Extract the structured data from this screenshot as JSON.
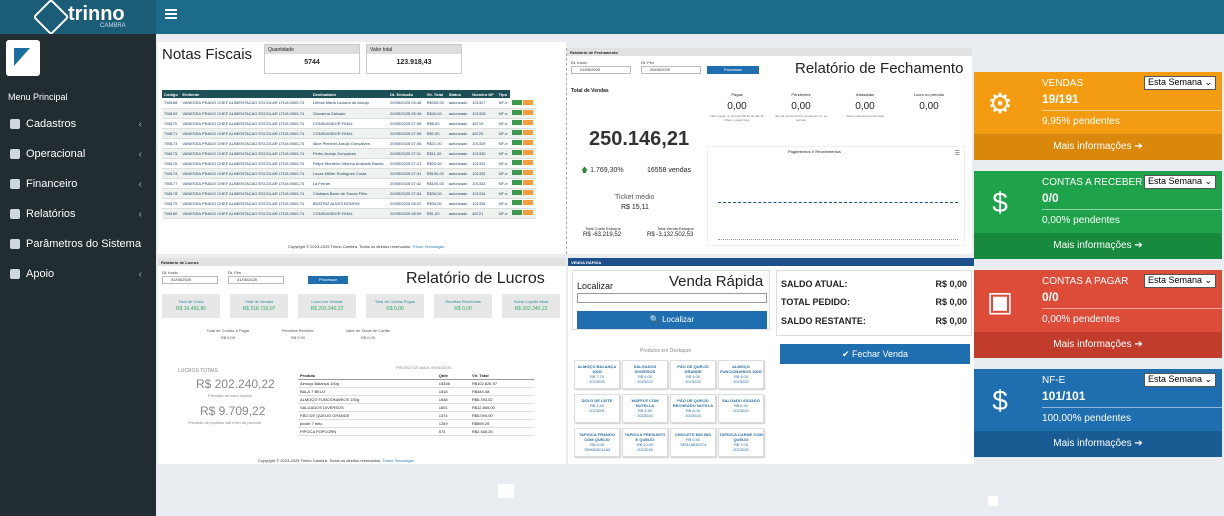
{
  "brand": {
    "name": "trinno",
    "sub": "CAMBRA"
  },
  "sidebar": {
    "header": "Menu Principal",
    "items": [
      {
        "label": "Cadastros"
      },
      {
        "label": "Operacional"
      },
      {
        "label": "Financeiro"
      },
      {
        "label": "Relatórios"
      },
      {
        "label": "Parâmetros do Sistema"
      },
      {
        "label": "Apoio"
      }
    ]
  },
  "notas": {
    "title": "Notas Fiscais",
    "qty_label": "Quantidade",
    "qty": "5744",
    "total_label": "Valor total",
    "total": "123.918,43",
    "columns": [
      "Código",
      "Emitente",
      "Destinatário",
      "Dt. Emissão",
      "Vlr. Total",
      "Status",
      "Número NF",
      "Tipo"
    ],
    "rows": [
      [
        "798188",
        "VANESSA PRADO CHEF ALIMENTACAO ESCOLAR LTDA 0000-74",
        "Letícia Maria Luciano de Araújo",
        "20/05/2025 05:48",
        "R$305,00",
        "autorizado",
        "100",
        "101327",
        "NF-e"
      ],
      [
        "798199",
        "VANESSA PRADO CHEF ALIMENTACAO ESCOLAR LTDA 0000-74",
        "Giovanna Salvado",
        "20/05/2025 05:49",
        "R$40,00",
        "autorizado",
        "100",
        "101328",
        "NF-e"
      ],
      [
        "798170",
        "VANESSA PRADO CHEF ALIMENTACAO ESCOLAR LTDA 0000-74",
        "CONSUMIDOR FINAL",
        "20/05/2025 07:08",
        "R$8,00",
        "autorizado",
        "100",
        "48719",
        "NF-e"
      ],
      [
        "798171",
        "VANESSA PRADO CHEF ALIMENTACAO ESCOLAR LTDA 0000-74",
        "CONSUMIDOR FINAL",
        "20/05/2025 07:08",
        "R$2,00",
        "autorizado",
        "100",
        "48720",
        "NF-e"
      ],
      [
        "798173",
        "VANESSA PRADO CHEF ALIMENTACAO ESCOLAR LTDA 0000-74",
        "Alice Pinheiro Araújo Gonçalves",
        "20/05/2025 07:08",
        "R$21,00",
        "autorizado",
        "100",
        "101329",
        "NF-e"
      ],
      [
        "798175",
        "VANESSA PRADO CHEF ALIMENTACAO ESCOLAR LTDA 0000-74",
        "Pedro Araújo Gonçalves",
        "20/05/2025 07:11",
        "R$11,00",
        "autorizado",
        "100",
        "101330",
        "NF-e"
      ],
      [
        "798176",
        "VANESSA PRADO CHEF ALIMENTACAO ESCOLAR LTDA 0000-74",
        "Felipe Monteiro Vitorino Andrade Bacha",
        "20/05/2025 07:21",
        "R$20,00",
        "autorizado",
        "100",
        "101331",
        "NF-e"
      ],
      [
        "798174",
        "VANESSA PRADO CHEF ALIMENTACAO ESCOLAR LTDA 0000-74",
        "Lucas Müller Rodrigues Costa",
        "20/05/2025 07:31",
        "R$100,00",
        "autorizado",
        "100",
        "101332",
        "NF-e"
      ],
      [
        "798177",
        "VANESSA PRADO CHEF ALIMENTACAO ESCOLAR LTDA 0000-74",
        "La Ferrari",
        "20/05/2025 07:42",
        "R$100,00",
        "autorizado",
        "100",
        "101333",
        "NF-e"
      ],
      [
        "798178",
        "VANESSA PRADO CHEF ALIMENTACAO ESCOLAR LTDA 0000-74",
        "Cristiana Barro de Souza Filho",
        "20/05/2025 07:54",
        "R$30,00",
        "autorizado",
        "100",
        "101334",
        "NF-e"
      ],
      [
        "798179",
        "VANESSA PRADO CHEF ALIMENTACAO ESCOLAR LTDA 0000-74",
        "BEATRIZ ALVES BONFIM",
        "20/05/2025 08:02",
        "R$30,00",
        "autorizado",
        "100",
        "101335",
        "NF-e"
      ],
      [
        "798180",
        "VANESSA PRADO CHEF ALIMENTACAO ESCOLAR LTDA 0000-74",
        "CONSUMIDOR FINAL",
        "20/05/2025 08:09",
        "R$1,00",
        "autorizado",
        "100",
        "48721",
        "NF-e"
      ]
    ],
    "btn_edit": "editar",
    "btn_xml": "xml",
    "footer": "Copyright © 2023-2025 Trinno Cambra. Todos os direitos reservados.",
    "footer_link": "Trinno Tecnologia"
  },
  "lucros": {
    "header": "Relatório de Lucros",
    "title": "Relatório de Lucros",
    "dt_inicio_label": "Dt. Início",
    "dt_inicio": "01/05/2025",
    "dt_fim_label": "Dt. Fim",
    "dt_fim": "31/05/2025",
    "btn": "Processar",
    "kpis": [
      {
        "t": "Total de Custo",
        "v": "R$ 16.492,86"
      },
      {
        "t": "Total de Vendas",
        "v": "R$ 218.733,07"
      },
      {
        "t": "Lucro em Vendas",
        "v": "R$ 202.240,22"
      },
      {
        "t": "Total de Contas Pagas",
        "v": "R$ 0,00"
      },
      {
        "t": "Receitas Recebidas",
        "v": "R$ 0,00"
      },
      {
        "t": "Saldo Líquido Atual",
        "v": "R$ 202.240,22"
      }
    ],
    "sub": [
      {
        "t": "Total de Contas à Pagar",
        "v": "R$ 0,00"
      },
      {
        "t": "Receitas Receber",
        "v": "R$ 0,00"
      },
      {
        "t": "Valor de Taxas de Cartão",
        "v": "R$ 0,00"
      }
    ],
    "lucros_label": "LUCROS TOTAIS",
    "lucro_total": "R$ 202.240,22",
    "lucro_total_note": "Previsão de lucro líquido",
    "lucro2": "R$ 9.709,22",
    "lucro2_note": "Previsão de pedidos até o fim do período",
    "prod_label": "PRODUTOS MAIS VENDIDOS",
    "prod_cols": [
      "Produto",
      "Qtde",
      "Vlr. Total"
    ],
    "prods": [
      [
        "Almoço Balança 100g",
        "15336",
        "R$102.826,97"
      ],
      [
        "BALA 7 BELO",
        "1818",
        "R$484,48"
      ],
      [
        "ALMOÇO FUNCIONARIOS 100g",
        "1648",
        "R$6.393,52"
      ],
      [
        "SALGADOS DIVERSOS",
        "1601",
        "R$12.808,00"
      ],
      [
        "PÃO DE QUEIJO GRANDE",
        "1374",
        "R$5.094,00"
      ],
      [
        "picolé 7 belo",
        "1259",
        "R$899,25"
      ],
      [
        "PIPOCA POPCORN",
        "574",
        "R$2.468,25"
      ]
    ],
    "footer": "Copyright © 2023-2025 Trinno Cambra. Todos os direitos reservados.",
    "footer_link": "Trinno Tecnologia"
  },
  "fechamento": {
    "header": "Relatório de Fechamento",
    "title": "Relatório de Fechamento",
    "dt_inicio_label": "Dt. Início",
    "dt_inicio": "01/05/2025",
    "dt_fim_label": "Dt. Fim",
    "dt_fim": "26/05/2025",
    "btn": "Processar",
    "total_label": "Total de Vendas",
    "total": "250.146,21",
    "growth": "1.769,30%",
    "vendas": "16558 vendas",
    "ticket_label": "Ticket médio",
    "ticket": "R$ 15,11",
    "custo_label": "Total Custo Estoque",
    "custo": "R$ -63.219,52",
    "venda_estoque_label": "Total Venda Estoque",
    "venda_estoque": "R$ -3.132.502,53",
    "stats": [
      {
        "t": "Pagas",
        "v": "0,00",
        "n": "Valor pagas no período R$ 45,00 não foi lhões o pagar hoje"
      },
      {
        "t": "Pendentes",
        "v": "0,00",
        "n": "não há recebimentos pendentes nrf, ao período"
      },
      {
        "t": "Atrasadas",
        "v": "0,00",
        "n": "atraso superiores a três dias"
      },
      {
        "t": "Lucro no período",
        "v": "0,00",
        "n": ""
      }
    ],
    "chart_title": "Pagamentos X Recebimentos"
  },
  "venda": {
    "header": "VENDA RÁPIDA",
    "title": "Venda Rápida",
    "localizar_label": "Localizar",
    "btn": "Localizar",
    "destaque": "Produtos em Destaque",
    "products": [
      {
        "n": "ALMOÇO BALANÇA 100G",
        "p": "R$ 7,70",
        "c": "2023025"
      },
      {
        "n": "SALGADOS DIVERSOS",
        "p": "R$ 6,00",
        "c": "2023023"
      },
      {
        "n": "PÃO DE QUEIJO GRANDE",
        "p": "R$ 4,00",
        "c": "2023024"
      },
      {
        "n": "ALMOÇO FUNCIONARIOS 100G",
        "p": "R$ 4,00",
        "c": "2023022"
      },
      {
        "n": "DOLO DE LEITE",
        "p": "R$ 1,50",
        "c": "2023001"
      },
      {
        "n": "WAFFLE COM NUTELLA",
        "p": "R$ 4,50",
        "c": "2023010"
      },
      {
        "n": "PÃO DE QUEIJO RECHEADO NUTELA",
        "p": "R$ 6,00",
        "c": "2023023"
      },
      {
        "n": "SALGADO ASSADO",
        "p": "R$ 6,40",
        "c": "2023022"
      },
      {
        "n": "TAPIOCA FRANGO COM QUEIJO",
        "p": "R$ 9,00",
        "c": "789652801163"
      },
      {
        "n": "TAPIOCA PRESUNTO E QUEIJO",
        "p": "R$ 10,00",
        "c": "2023018"
      },
      {
        "n": "CHICLETE BIG BIG",
        "p": "R$ 0,50",
        "c": "789118832974"
      },
      {
        "n": "TAPIOCA CARNE COM QUEIJO",
        "p": "R$ 7,00",
        "c": "2023020"
      }
    ],
    "saldo_atual_label": "SALDO ATUAL:",
    "saldo_atual": "R$ 0,00",
    "total_pedido_label": "TOTAL PEDIDO:",
    "total_pedido": "R$ 0,00",
    "saldo_restante_label": "SALDO RESTANTE:",
    "saldo_restante": "R$ 0,00",
    "fechar": "Fechar Venda"
  },
  "tiles": [
    {
      "title": "VENDAS",
      "num": "19/191",
      "sel": "Esta Semana",
      "pct": "9,95% pendentes",
      "more": "Mais informações",
      "color": "#f39c12",
      "dark": "#d9880c",
      "icon": "gears-icon"
    },
    {
      "title": "CONTAS A RECEBER",
      "num": "0/0",
      "sel": "Esta Semana",
      "pct": "0,00% pendentes",
      "more": "Mais informações",
      "color": "#1fa34a",
      "dark": "#178a3d",
      "icon": "dollar-icon"
    },
    {
      "title": "CONTAS A PAGAR",
      "num": "0/0",
      "sel": "Esta Semana",
      "pct": "0,00% pendentes",
      "more": "Mais informações",
      "color": "#dd4b39",
      "dark": "#c23c2c",
      "icon": "money-icon"
    },
    {
      "title": "NF-E",
      "num": "101/101",
      "sel": "Esta Semana",
      "pct": "100,00% pendentes",
      "more": "Mais informações",
      "color": "#1f6fb0",
      "dark": "#195c94",
      "icon": "dollar-icon"
    }
  ]
}
